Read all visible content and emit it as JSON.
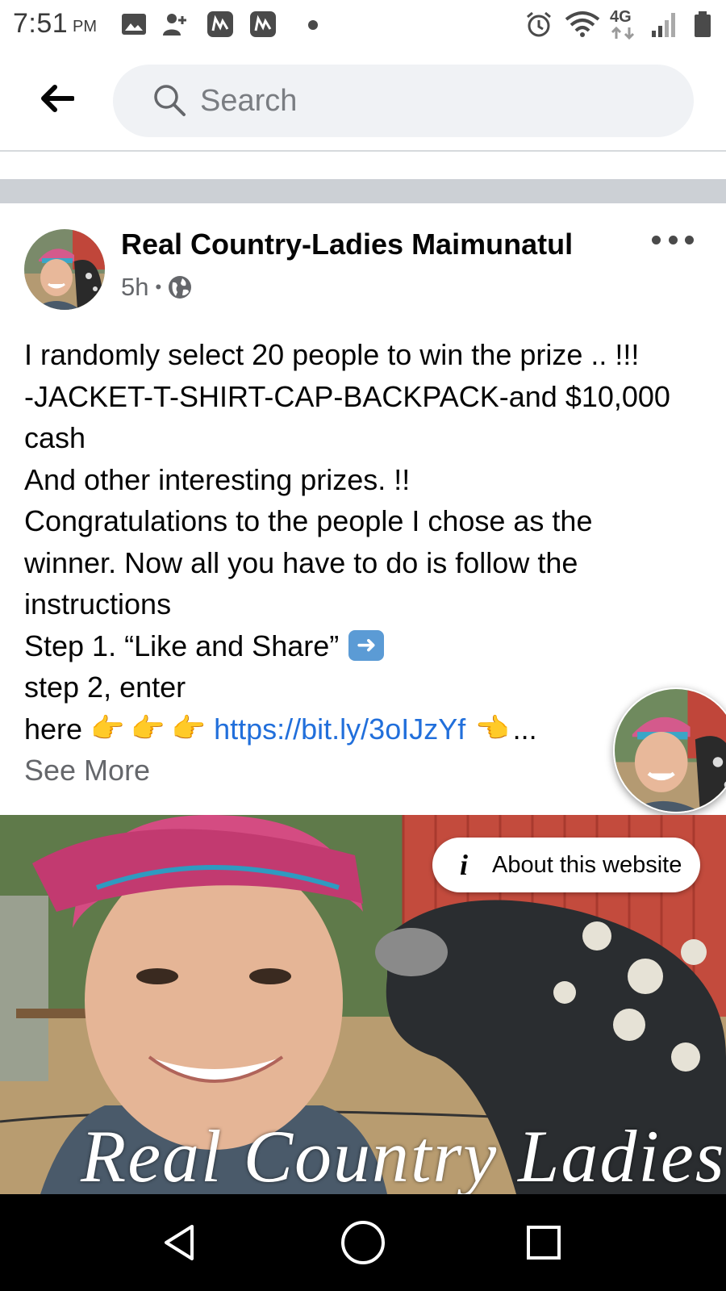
{
  "status_bar": {
    "time": "7:51",
    "ampm": "PM",
    "network": "4G"
  },
  "search": {
    "placeholder": "Search"
  },
  "post": {
    "author": "Real Country-Ladies Maimunatul",
    "time_ago": "5h",
    "separator": "•",
    "text_lines": [
      "I randomly select 20 people to win the prize .. !!!",
      "-JACKET-T-SHIRT-CAP-BACKPACK-and $10,000",
      "cash",
      "And other interesting prizes. !!",
      "Congratulations to the people I chose as the",
      "winner. Now all you have to do is follow the",
      "instructions",
      "Step 1. “Like and Share”",
      "step 2, enter"
    ],
    "last_line_prefix": "here",
    "link": "https://bit.ly/3oIJzYf",
    "ellipsis": "...",
    "see_more": "See More",
    "image_watermark": "Real Country Ladies",
    "about_label": "About this website"
  },
  "colors": {
    "link": "#216fdb",
    "secondary_text": "#65676b",
    "search_bg": "#f0f2f5"
  }
}
